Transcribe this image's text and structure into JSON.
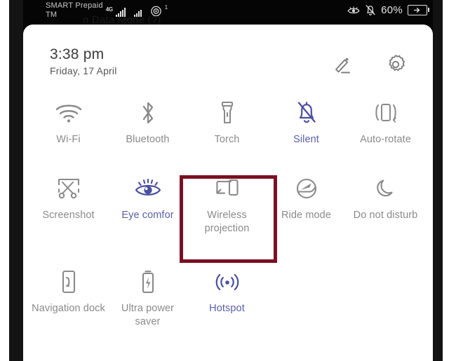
{
  "statusbar": {
    "carrier": "SMART Prepaid\nTM",
    "network_type": "4G",
    "sim2_superscript": "1",
    "ghost_text": "n Data Mode (?)",
    "battery_percent": "60%",
    "icons": [
      "eye-comfort-icon",
      "silent-bell-icon",
      "battery-charging-icon",
      "signal-bars-icon",
      "wifi-ap-icon"
    ]
  },
  "panel": {
    "clock": {
      "time": "3:38 pm",
      "date": "Friday, 17 April"
    },
    "actions": [
      {
        "name": "edit-button",
        "label": "Edit"
      },
      {
        "name": "settings-button",
        "label": "Settings"
      }
    ]
  },
  "tiles": [
    {
      "label": "Wi-Fi",
      "icon": "wifi-icon",
      "active": false
    },
    {
      "label": "Bluetooth",
      "icon": "bluetooth-icon",
      "active": false
    },
    {
      "label": "Torch",
      "icon": "torch-icon",
      "active": false
    },
    {
      "label": "Silent",
      "icon": "silent-bell-icon",
      "active": true
    },
    {
      "label": "Auto-rotate",
      "icon": "auto-rotate-icon",
      "active": false
    },
    {
      "label": "Screenshot",
      "icon": "screenshot-icon",
      "active": false
    },
    {
      "label": "Eye comfor",
      "icon": "eye-comfort-icon",
      "active": true
    },
    {
      "label": "Wireless projection",
      "icon": "wireless-projection-icon",
      "active": false
    },
    {
      "label": "Ride mode",
      "icon": "ride-mode-helmet-icon",
      "active": false
    },
    {
      "label": "Do not disturb",
      "icon": "moon-icon",
      "active": false
    },
    {
      "label": "Navigation dock",
      "icon": "navigation-dock-icon",
      "active": false
    },
    {
      "label": "Ultra power saver",
      "icon": "ultra-power-saver-icon",
      "active": false
    },
    {
      "label": "Hotspot",
      "icon": "hotspot-icon",
      "active": true
    }
  ],
  "highlight": {
    "target_label": "Wireless projection",
    "color": "#7b1022"
  },
  "colors": {
    "inactive": "#8a8a8a",
    "active": "#5a5fa6",
    "panel_bg": "#ffffff",
    "bezel": "#050505",
    "highlight": "#7b1022"
  }
}
